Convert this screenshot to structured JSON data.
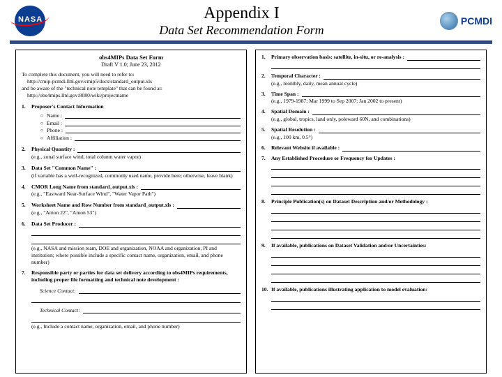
{
  "header": {
    "nasa_text": "NASA",
    "title": "Appendix I",
    "subtitle": "Data Set Recommendation Form",
    "pcmdi_text": "PCMDI"
  },
  "left": {
    "form_title": "obs4MIPs Data Set Form",
    "form_sub": "Draft V 1.0; June 23, 2012",
    "intro_lead": "To complete this document, you will need to refer to:",
    "intro_1": "http://cmip-pcmdi.llnl.gov/cmip5/docs/standard_output.xls",
    "intro_2": "and be aware of the \"technical note template\" that can be found at:",
    "intro_3": "http://obs4mips.llnl.gov:8080/wiki/projectname",
    "i1_label": "Proposer's Contact Information",
    "i1_f1": "Name :",
    "i1_f2": "Email :",
    "i1_f3": "Phone :",
    "i1_f4": "Affiliation :",
    "i2_label": "Physical Quantity :",
    "i2_hint": "(e.g., zonal surface wind, total column water vapor)",
    "i3_label": "Data Set \"Common Name\" :",
    "i3_hint": "(if variable has a well-recognized, commonly used name, provide here; otherwise, leave blank)",
    "i4_label": "CMOR Long Name from standard_output.xls :",
    "i4_hint": "(e.g., \"Eastward Near-Surface Wind\", \"Water Vapor Path\")",
    "i5_label": "Worksheet Name and Row Number from standard_output.xls :",
    "i5_hint": "(e.g., \"Amon 22\", \"Amon 53\")",
    "i6_label": "Data Set Producer :",
    "i6_hint": "(e.g., NASA and mission team, DOE and organization, NOAA and organization, PI and institution; where possible include a specific contact name, organization, email, and phone number)",
    "i7_label": "Responsible party or parties for data set delivery according to obs4MIPs requirements, including proper file formatting and technical note development :",
    "i7_sub1": "Science Contact:",
    "i7_sub2": "Technical Contact:",
    "i7_hint": "(e.g., Include a contact name, organization, email, and phone number)"
  },
  "right": {
    "i1_label": "Primary observation basis: satellite, in-situ, or re-analysis :",
    "i2_label": "Temporal Character :",
    "i2_hint": "(e.g., monthly, daily, mean annual cycle)",
    "i3_label": "Time Span :",
    "i3_hint": "(e.g., 1979-1987; Mar 1999 to Sep 2007; Jan 2002 to present)",
    "i4_label": "Spatial Domain :",
    "i4_hint": "(e.g., global, tropics, land only, poleward 60N, and combinations)",
    "i5_label": "Spatial Resolution :",
    "i5_hint": "(e.g., 100 km, 0.5°)",
    "i6_label": "Relevant Website if available :",
    "i7_label": "Any Established Procedure or Frequency for Updates :",
    "i8_label": "Principle Publication(s) on Dataset Description and/or Methodology :",
    "i9_label": "If available, publications on Dataset Validation and/or Uncertainties:",
    "i10_label": "If available, publications illustrating application to model evaluation:"
  }
}
